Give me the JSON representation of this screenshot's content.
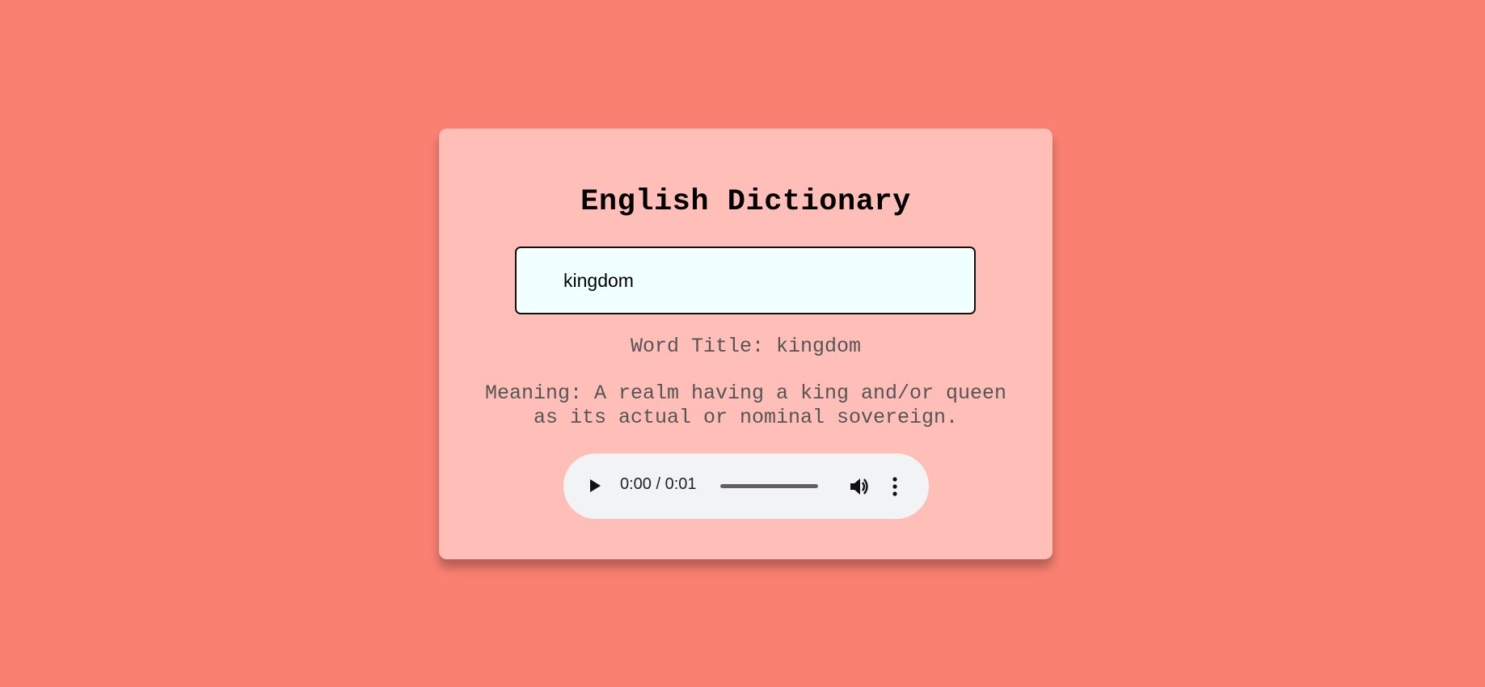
{
  "page": {
    "background_color": "#fa8072",
    "card_color": "#ffbfb8"
  },
  "app": {
    "title": "English Dictionary"
  },
  "search": {
    "value": "kingdom",
    "input_background": "#f0ffff"
  },
  "result": {
    "word_title": "Word Title: kingdom",
    "meaning": "Meaning: A realm having a king and/or queen as its actual or nominal sovereign."
  },
  "audio": {
    "time_display": "0:00 / 0:01",
    "progress_fraction": 0,
    "icons": {
      "play": "play-icon",
      "volume": "volume-icon",
      "more": "more-options-icon"
    },
    "background_color": "#f1f3f4"
  }
}
